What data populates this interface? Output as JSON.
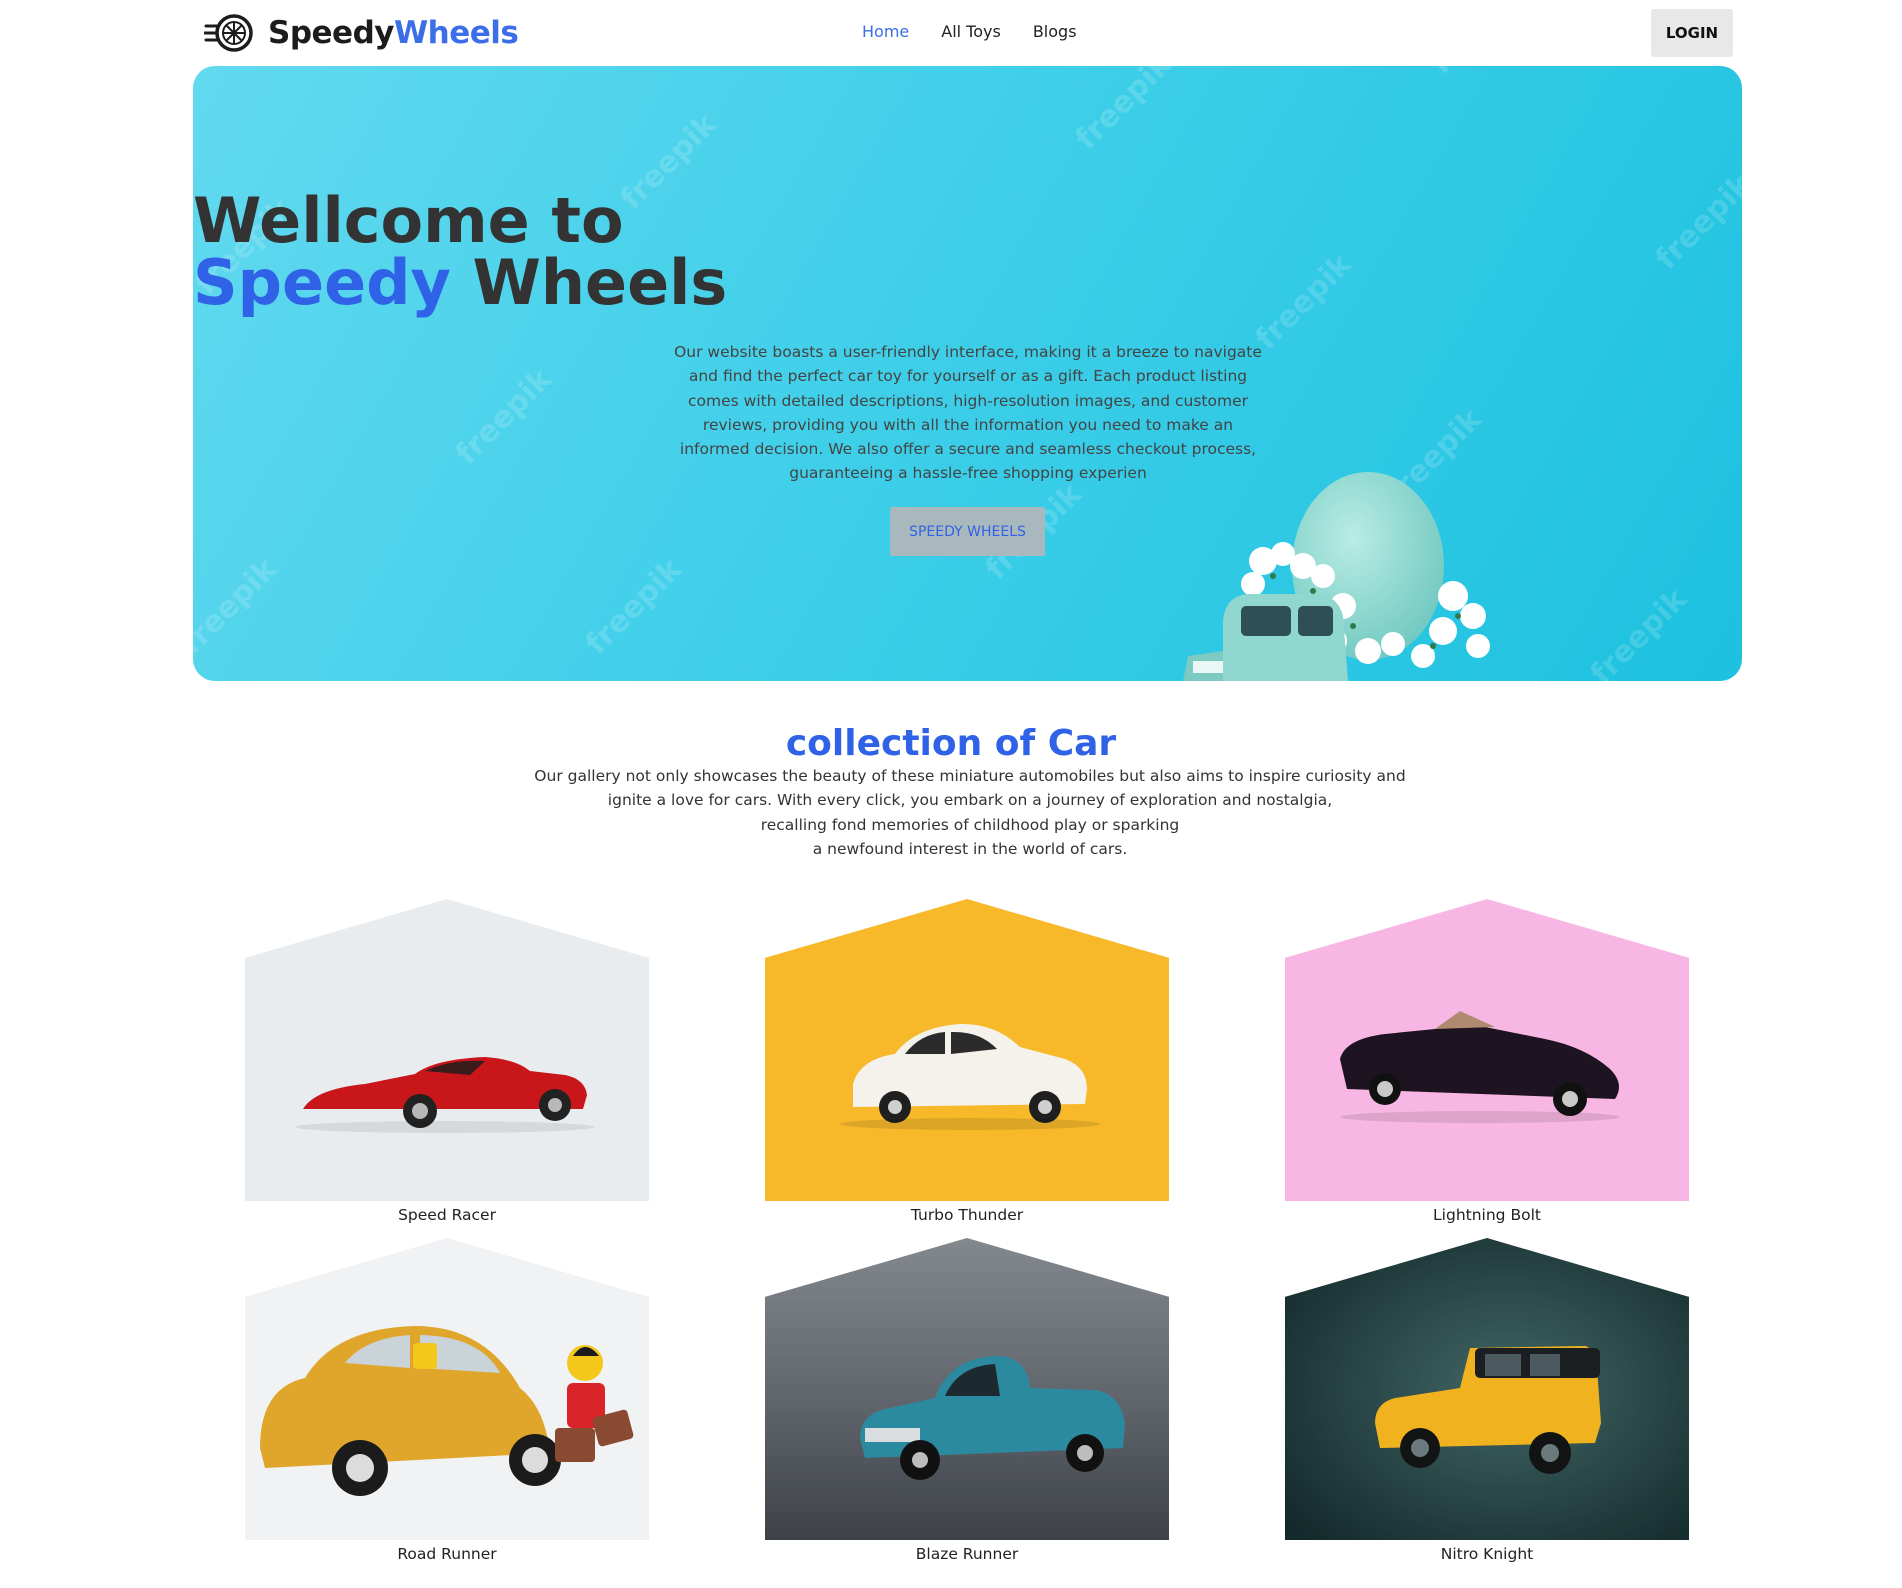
{
  "nav": {
    "brand_main": "Speedy",
    "brand_accent": "Wheels",
    "links": [
      {
        "label": "Home",
        "active": true
      },
      {
        "label": "All Toys",
        "active": false
      },
      {
        "label": "Blogs",
        "active": false
      }
    ],
    "login_label": "LOGIN"
  },
  "hero": {
    "title_line1": "Wellcome to",
    "title_accent": "Speedy",
    "title_rest": " Wheels",
    "text": "Our website boasts a user-friendly interface, making it a breeze to navigate and find the perfect car toy for yourself or as a gift. Each product listing comes with detailed descriptions, high-resolution images, and customer reviews, providing you with all the information you need to make an informed decision. We also offer a secure and seamless checkout process, guaranteeing a hassle-free shopping experien",
    "button_label": "SPEEDY WHEELS",
    "watermark": "freepik"
  },
  "collection": {
    "title": "collection of Car",
    "text_lines": [
      "Our gallery not only showcases the beauty of these miniature automobiles but also aims to inspire curiosity and",
      "ignite a love for cars. With every click, you embark on a journey of exploration and nostalgia,",
      "recalling fond memories of childhood play or sparking",
      "a newfound interest in the world of cars."
    ]
  },
  "cars": [
    {
      "name": "Speed Racer",
      "background": "#e9ecef",
      "car_color": "#c9161b"
    },
    {
      "name": "Turbo Thunder",
      "background": "#f7b82a",
      "car_color": "#f4f2ea"
    },
    {
      "name": "Lightning Bolt",
      "background": "#f7b6e3",
      "car_color": "#1e1320"
    },
    {
      "name": "Road Runner",
      "background": "#f1f2f4",
      "car_color": "#e0a52b"
    },
    {
      "name": "Blaze Runner",
      "background": "#6b7178",
      "car_color": "#2b8aa0"
    },
    {
      "name": "Nitro Knight",
      "background": "#1f3c3e",
      "car_color": "#f1b21f"
    }
  ],
  "colors": {
    "accent": "#3b6ee8",
    "hero_bg": "#3fcfe9"
  }
}
